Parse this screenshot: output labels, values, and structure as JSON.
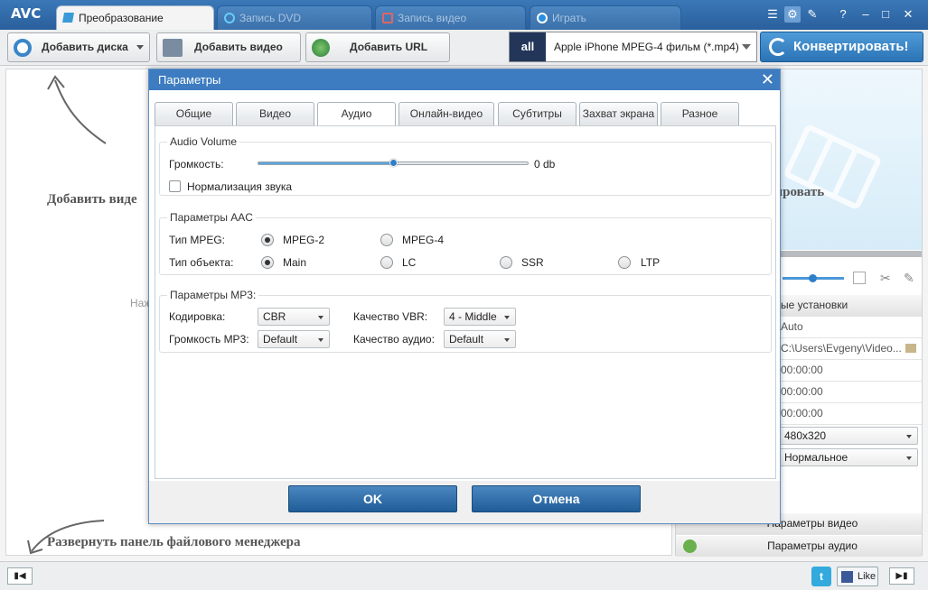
{
  "app": {
    "logo": "AVC"
  },
  "tabs": [
    {
      "label": "Преобразование",
      "active": true
    },
    {
      "label": "Запись DVD",
      "active": false
    },
    {
      "label": "Запись видео",
      "active": false
    },
    {
      "label": "Играть",
      "active": false
    }
  ],
  "toolbar": {
    "add_disc": "Добавить диска",
    "add_video": "Добавить видео",
    "add_url": "Добавить URL",
    "profile": "Apple iPhone MPEG-4 фильм (*.mp4)",
    "profile_icon": "all",
    "convert": "Конвертировать!"
  },
  "main": {
    "hint_add": "Добавить виде",
    "hint_click": "Наж",
    "hint_expand": "Развернуть панель файлового менеджера"
  },
  "right": {
    "hint_convert": "ртировать",
    "settings_label": "ые установки",
    "rows": [
      "Auto",
      "C:\\Users\\Evgeny\\Video...",
      "00:00:00",
      "00:00:00",
      "00:00:00",
      "480x320",
      "Нормальное"
    ],
    "video_params": "Параметры видео",
    "audio_params": "Параметры аудио"
  },
  "status": {
    "like": "Like"
  },
  "dialog": {
    "title": "Параметры",
    "tabs": [
      "Общие",
      "Видео",
      "Аудио",
      "Онлайн-видео",
      "Субтитры",
      "Захват экрана",
      "Разное"
    ],
    "active_tab": "Аудио",
    "volume": {
      "group": "Audio Volume",
      "label": "Громкость:",
      "value": "0 db",
      "level": 0.5,
      "normalize": "Нормализация звука",
      "normalize_checked": false
    },
    "aac": {
      "group": "Параметры AAC",
      "mpeg_label": "Тип MPEG:",
      "mpeg_options": [
        "MPEG-2",
        "MPEG-4"
      ],
      "mpeg_selected": "MPEG-2",
      "object_label": "Тип объекта:",
      "object_options": [
        "Main",
        "LC",
        "SSR",
        "LTP"
      ],
      "object_selected": "Main"
    },
    "mp3": {
      "group": "Параметры MP3:",
      "encoding_label": "Кодировка:",
      "encoding": "CBR",
      "vbr_label": "Качество VBR:",
      "vbr": "4 - Middle",
      "mp3vol_label": "Громкость MP3:",
      "mp3vol": "Default",
      "quality_label": "Качество аудио:",
      "quality": "Default"
    },
    "ok": "OK",
    "cancel": "Отмена"
  },
  "colors": {
    "accent": "#3d7cc0",
    "titlebar": "#2a5f9c"
  }
}
